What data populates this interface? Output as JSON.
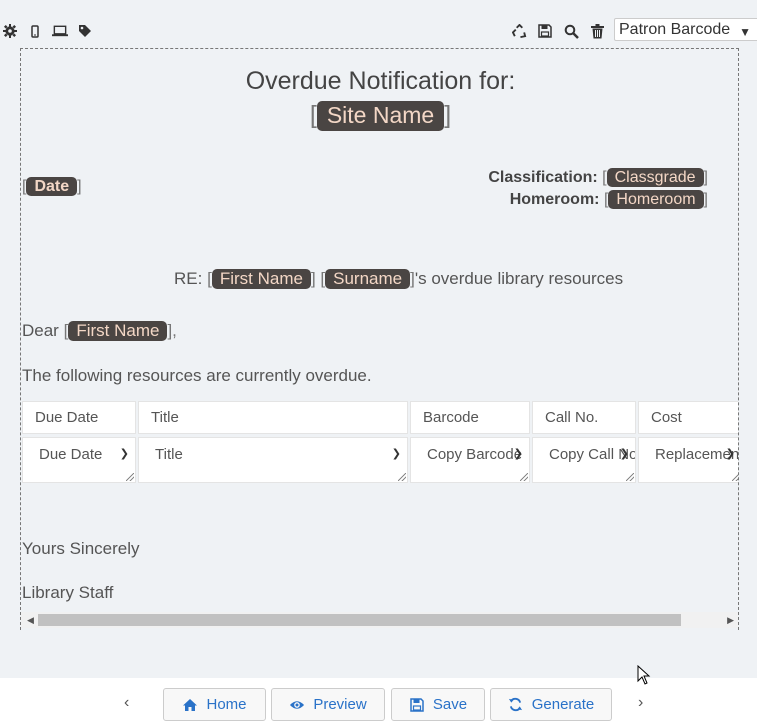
{
  "toolbar_left": {
    "icons": [
      "gear-icon",
      "mobile-icon",
      "laptop-icon",
      "tag-icon"
    ]
  },
  "toolbar_right": {
    "icons": [
      "recycle-icon",
      "save-icon",
      "search-icon",
      "trash-icon"
    ],
    "select_value": "Patron Barcode"
  },
  "document": {
    "heading": "Overdue Notification for:",
    "site_name": "Site Name",
    "date_tag": "Date",
    "classification_label": "Classification:",
    "classification_tag": "Classgrade",
    "homeroom_label": "Homeroom:",
    "homeroom_tag": "Homeroom",
    "re_prefix": "RE:",
    "first_name_tag": "First Name",
    "surname_tag": "Surname",
    "re_suffix": "'s overdue library resources",
    "dear": "Dear",
    "dear_name_tag": "First Name",
    "intro": "The following resources are currently overdue.",
    "table": {
      "headers": [
        "Due Date",
        "Title",
        "Barcode",
        "Call No.",
        "Cost"
      ],
      "selects": [
        "Due Date",
        "Title",
        "Copy Barcode",
        "Copy Call No.",
        "Replacement Cost"
      ]
    },
    "closing": "Yours Sincerely",
    "signature": "Library Staff"
  },
  "footer": {
    "home_label": "Home",
    "preview_label": "Preview",
    "save_label": "Save",
    "generate_label": "Generate",
    "accent": "#2a72c8"
  }
}
